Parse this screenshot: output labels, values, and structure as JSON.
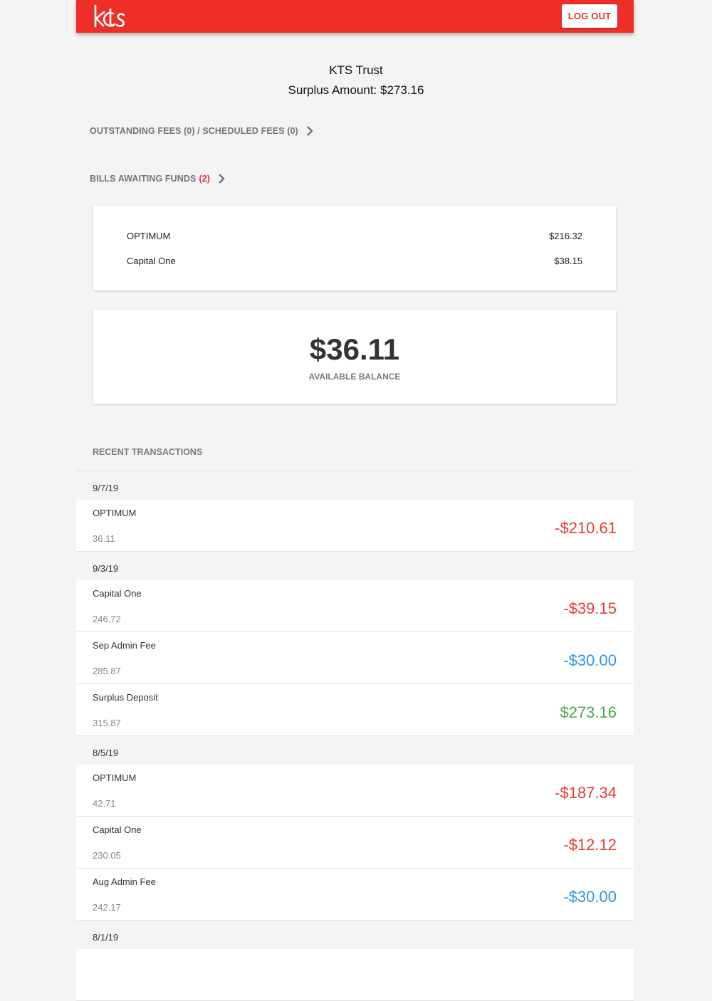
{
  "header": {
    "logo_text": "kts",
    "logout_label": "LOG OUT",
    "brand_color": "#ee2e28"
  },
  "account": {
    "name": "KTS Trust",
    "surplus": "Surplus Amount: $273.16"
  },
  "fees_link": {
    "label": "OUTSTANDING FEES (0) / SCHEDULED FEES (0)",
    "icon": "chevron-right-icon"
  },
  "bills_link": {
    "label": "BILLS AWAITING FUNDS",
    "count": "(2)",
    "icon": "chevron-right-icon"
  },
  "bills": [
    {
      "name": "OPTIMUM",
      "amount": "$216.32"
    },
    {
      "name": "Capital One",
      "amount": "$38.15"
    }
  ],
  "balance": {
    "amount": "$36.11",
    "label": "AVAILABLE BALANCE"
  },
  "recent": {
    "title": "RECENT TRANSACTIONS",
    "groups": [
      {
        "date": "9/7/19",
        "items": [
          {
            "name": "OPTIMUM",
            "balance": "36.11",
            "amount": "-$210.61",
            "color": "red"
          }
        ]
      },
      {
        "date": "9/3/19",
        "items": [
          {
            "name": "Capital One",
            "balance": "246.72",
            "amount": "-$39.15",
            "color": "red"
          },
          {
            "name": "Sep Admin Fee",
            "balance": "285.87",
            "amount": "-$30.00",
            "color": "blue"
          },
          {
            "name": "Surplus Deposit",
            "balance": "315.87",
            "amount": "$273.16",
            "color": "green"
          }
        ]
      },
      {
        "date": "8/5/19",
        "items": [
          {
            "name": "OPTIMUM",
            "balance": "42.71",
            "amount": "-$187.34",
            "color": "red"
          },
          {
            "name": "Capital One",
            "balance": "230.05",
            "amount": "-$12.12",
            "color": "red"
          },
          {
            "name": "Aug Admin Fee",
            "balance": "242.17",
            "amount": "-$30.00",
            "color": "blue"
          }
        ]
      },
      {
        "date": "8/1/19",
        "items": []
      }
    ]
  },
  "colors": {
    "debit": "#ea3b33",
    "fee": "#2f98e4",
    "deposit": "#44ab48"
  }
}
